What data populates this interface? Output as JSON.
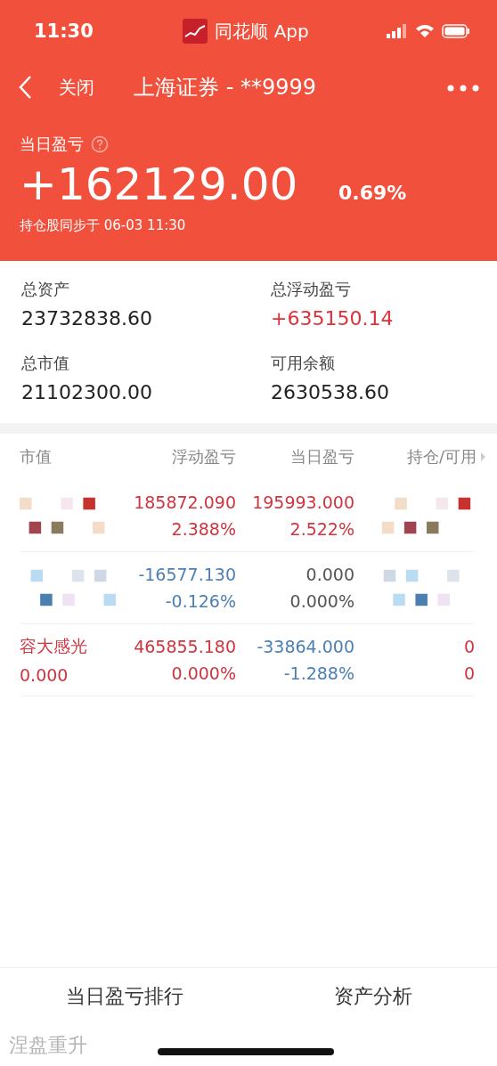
{
  "status_bar": {
    "time": "11:30",
    "app": "同花顺 App"
  },
  "nav": {
    "back_label": "关闭",
    "title": "上海证券 - **9999"
  },
  "today": {
    "label": "当日盈亏",
    "value": "+162129.00",
    "percent": "0.69%",
    "sync": "持仓股同步于 06-03 11:30"
  },
  "summary": [
    {
      "label": "总资产",
      "value": "23732838.60",
      "color": "#222222"
    },
    {
      "label": "总浮动盈亏",
      "value": "+635150.14",
      "color": "#e0303a"
    },
    {
      "label": "总市值",
      "value": "21102300.00",
      "color": "#222222"
    },
    {
      "label": "可用余额",
      "value": "2630538.60",
      "color": "#222222"
    }
  ],
  "table": {
    "columns": [
      "市值",
      "浮动盈亏",
      "当日盈亏",
      "持仓/可用"
    ],
    "rows": [
      {
        "cells": [
          {
            "kind": "masked"
          },
          {
            "kind": "text",
            "lines": [
              {
                "text": "185872.090",
                "color": "#d0343f"
              },
              {
                "text": "2.388%",
                "color": "#d0343f"
              }
            ]
          },
          {
            "kind": "text",
            "lines": [
              {
                "text": "195993.000",
                "color": "#d0343f"
              },
              {
                "text": "2.522%",
                "color": "#d0343f"
              }
            ]
          },
          {
            "kind": "masked"
          }
        ]
      },
      {
        "cells": [
          {
            "kind": "masked"
          },
          {
            "kind": "text",
            "lines": [
              {
                "text": "-16577.130",
                "color": "#4b7fb3"
              },
              {
                "text": "-0.126%",
                "color": "#4b7fb3"
              }
            ]
          },
          {
            "kind": "text",
            "lines": [
              {
                "text": "0.000",
                "color": "#555555"
              },
              {
                "text": "0.000%",
                "color": "#555555"
              }
            ]
          },
          {
            "kind": "masked"
          }
        ]
      },
      {
        "cells": [
          {
            "kind": "text",
            "lines": [
              {
                "text": "容大感光",
                "color": "#d0343f"
              },
              {
                "text": "0.000",
                "color": "#d0343f"
              }
            ]
          },
          {
            "kind": "text",
            "lines": [
              {
                "text": "465855.180",
                "color": "#d0343f"
              },
              {
                "text": "0.000%",
                "color": "#d0343f"
              }
            ]
          },
          {
            "kind": "text",
            "lines": [
              {
                "text": "-33864.000",
                "color": "#4b7fb3"
              },
              {
                "text": "-1.288%",
                "color": "#4b7fb3"
              }
            ]
          },
          {
            "kind": "text",
            "lines": [
              {
                "text": "0",
                "color": "#d0343f"
              },
              {
                "text": "0",
                "color": "#d0343f"
              }
            ]
          }
        ]
      }
    ]
  },
  "bottom_tabs": [
    "当日盈亏排行",
    "资产分析"
  ],
  "caption": "涅盘重升"
}
